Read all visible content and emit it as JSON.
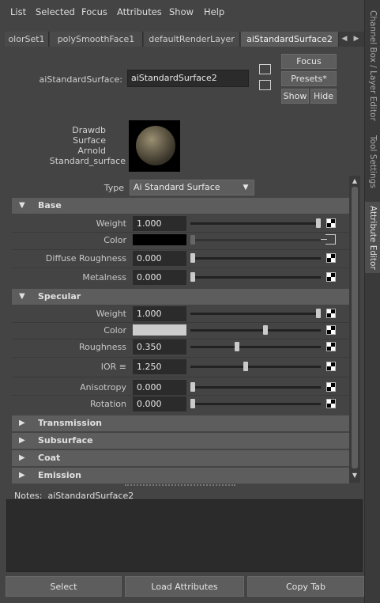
{
  "menubar": {
    "items": [
      "List",
      "Selected",
      "Focus",
      "Attributes",
      "Show",
      "Help"
    ]
  },
  "sidetabs": [
    "Channel Box / Layer Editor",
    "Tool Settings",
    "Attribute Editor"
  ],
  "nodetabs": [
    "olorSet1",
    "polySmoothFace1",
    "defaultRenderLayer",
    "aiStandardSurface2"
  ],
  "header": {
    "node_label": "aiStandardSurface:",
    "node_name": "aiStandardSurface2",
    "focus": "Focus",
    "presets": "Presets*",
    "show": "Show",
    "hide": "Hide"
  },
  "swatch": {
    "lines": [
      "Drawdb",
      "Surface",
      "Arnold",
      "Standard_surface"
    ]
  },
  "type": {
    "label": "Type",
    "value": "Ai Standard Surface"
  },
  "sections": {
    "base": {
      "title": "Base",
      "rows": [
        {
          "label": "Weight",
          "value": "1.000",
          "slider": 1.0
        },
        {
          "label": "Color",
          "color": "#000000",
          "slider": 0.0
        },
        {
          "label": "Diffuse Roughness",
          "value": "0.000",
          "slider": 0.0
        },
        {
          "label": "Metalness",
          "value": "0.000",
          "slider": 0.0
        }
      ]
    },
    "specular": {
      "title": "Specular",
      "rows": [
        {
          "label": "Weight",
          "value": "1.000",
          "slider": 1.0
        },
        {
          "label": "Color",
          "color": "#cdcdcd",
          "slider": 0.58
        },
        {
          "label": "Roughness",
          "value": "0.350",
          "slider": 0.35
        },
        {
          "label": "IOR ≡",
          "value": "1.250",
          "slider": 0.42
        },
        {
          "label": "Anisotropy",
          "value": "0.000",
          "slider": 0.0
        },
        {
          "label": "Rotation",
          "value": "0.000",
          "slider": 0.0
        }
      ]
    },
    "collapsed": [
      "Transmission",
      "Subsurface",
      "Coat",
      "Emission"
    ]
  },
  "notes": {
    "label": "Notes:",
    "node": "aiStandardSurface2"
  },
  "bottom": {
    "select": "Select",
    "load": "Load Attributes",
    "copy": "Copy Tab"
  },
  "colors": {
    "panel": "#444444",
    "field": "#2b2b2b",
    "section": "#5d5d5d"
  }
}
